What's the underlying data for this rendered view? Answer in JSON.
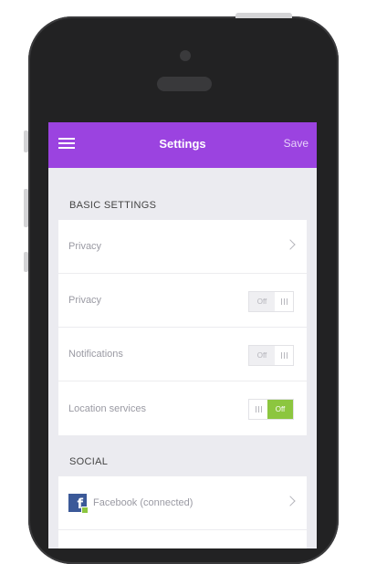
{
  "header": {
    "title": "Settings",
    "save_label": "Save"
  },
  "sections": {
    "basic": {
      "label": "BASIC SETTINGS",
      "rows": [
        {
          "label": "Privacy",
          "control": "chevron"
        },
        {
          "label": "Privacy",
          "control": "toggle",
          "toggle_text": "Off"
        },
        {
          "label": "Notifications",
          "control": "toggle",
          "toggle_text": "Off"
        },
        {
          "label": "Location services",
          "control": "toggle",
          "toggle_text": "Off"
        }
      ]
    },
    "social": {
      "label": "SOCIAL",
      "rows": [
        {
          "label": "Facebook (connected)",
          "icon": "facebook-icon",
          "badge_icon": "checkmark-badge-icon",
          "control": "chevron"
        }
      ]
    }
  },
  "colors": {
    "header": "#9b43e0",
    "toggle_active": "#8cc63f",
    "facebook": "#3b5998"
  }
}
